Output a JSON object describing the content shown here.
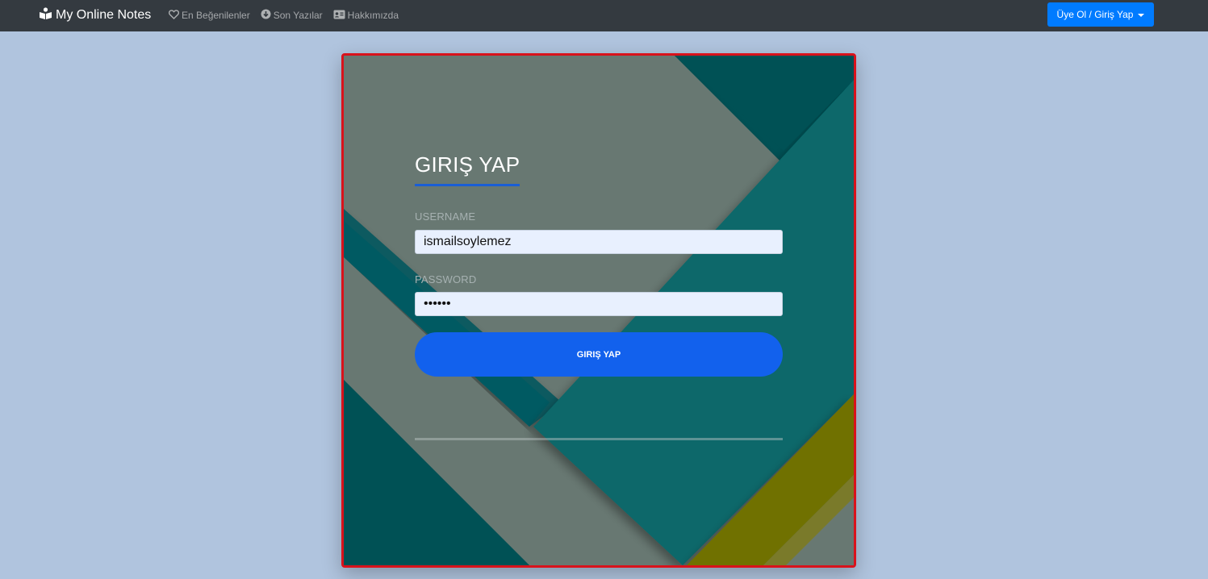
{
  "navbar": {
    "brand": "My Online Notes",
    "links": [
      {
        "label": "En Beğenilenler",
        "icon": "heart-icon"
      },
      {
        "label": "Son Yazılar",
        "icon": "arrow-down-circle-icon"
      },
      {
        "label": "Hakkımızda",
        "icon": "id-card-icon"
      }
    ],
    "auth_button": "Üye Ol / Giriş Yap"
  },
  "login": {
    "title": "GIRIŞ YAP",
    "username_label": "USERNAME",
    "username_value": "ismailsoylemez",
    "password_label": "PASSWORD",
    "password_value": "••••••",
    "submit_label": "GIRIŞ YAP"
  },
  "colors": {
    "navbar_bg": "#343a40",
    "page_bg": "#b0c4de",
    "primary": "#007bff",
    "submit": "#1261ed",
    "card_border": "#d9121b"
  }
}
